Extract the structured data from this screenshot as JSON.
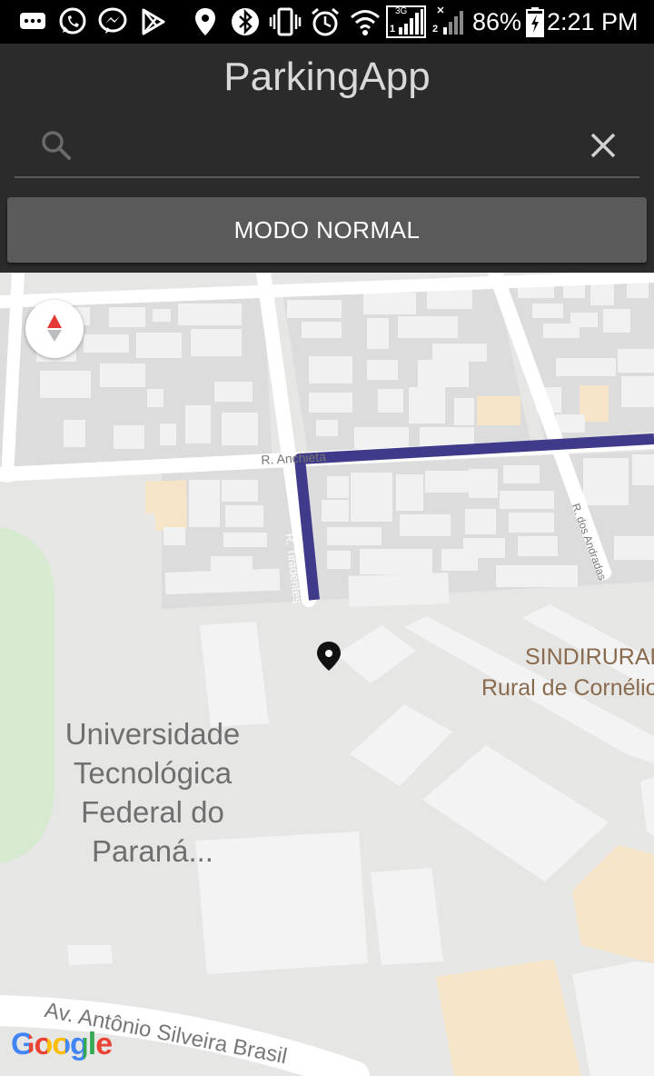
{
  "status_bar": {
    "battery": "86%",
    "time": "2:21 PM",
    "network_label": "3G",
    "sim1": "1",
    "sim2": "2"
  },
  "app": {
    "title": "ParkingApp"
  },
  "search": {
    "value": "",
    "placeholder": ""
  },
  "mode_button": {
    "label": "MODO NORMAL"
  },
  "map": {
    "streets": {
      "anchieta": "R. Anchieta",
      "tiradentes": "R. Tiradentes",
      "andradas": "R. dos Andradas",
      "avenida": "Av. Antônio Silveira Brasil"
    },
    "places": {
      "university_line1": "Universidade",
      "university_line2": "Tecnológica",
      "university_line3": "Federal do",
      "university_line4": "Paraná...",
      "sindirural_line1": "SINDIRURAL",
      "sindirural_line2": "Rural de Cornélio"
    },
    "route_color": "#3f3a8a",
    "attribution": "Google"
  }
}
